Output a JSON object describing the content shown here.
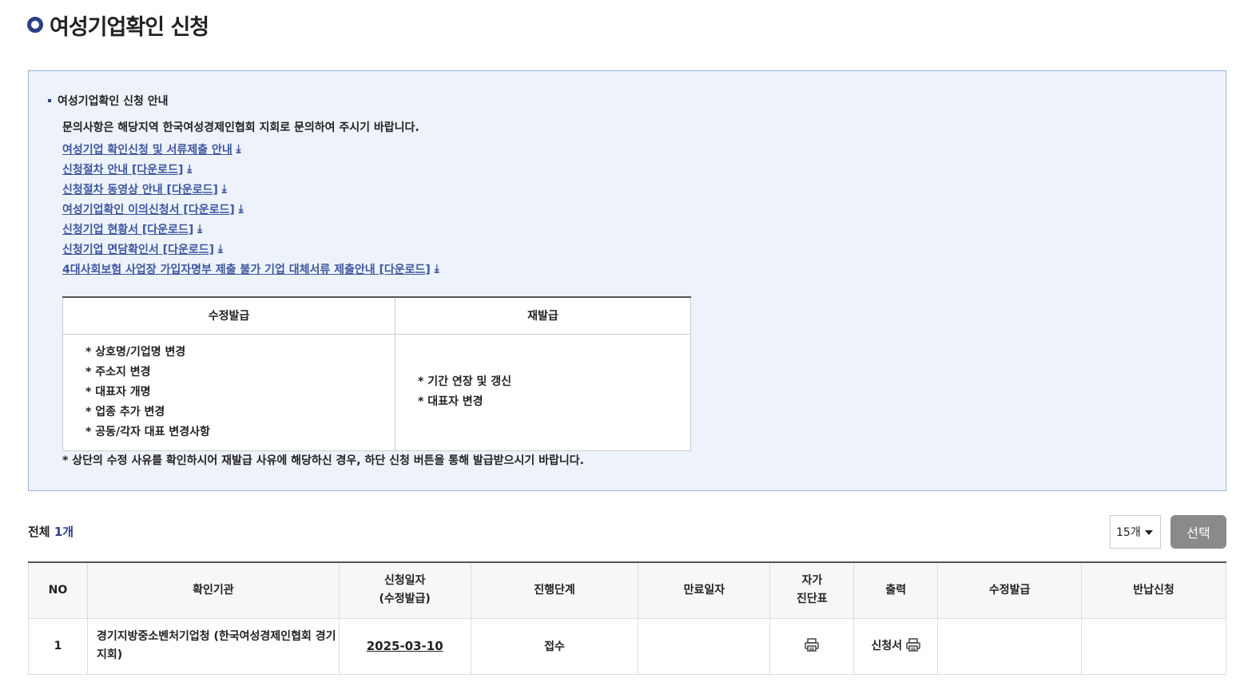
{
  "page": {
    "title": "여성기업확인 신청"
  },
  "guide": {
    "heading": "여성기업확인 신청 안내",
    "description": "문의사항은 해당지역 한국여성경제인협회 지회로 문의하여 주시기 바랍니다.",
    "links": [
      "여성기업 확인신청 및 서류제출 안내",
      "신청절차 안내 [다운로드]",
      "신청절차 동영상 안내 [다운로드]",
      "여성기업확인 이의신청서 [다운로드]",
      "신청기업 현황서 [다운로드]",
      "신청기업 면담확인서 [다운로드]",
      "4대사회보험 사업장 가입자명부 제출 불가 기업 대체서류 제출안내 [다운로드]"
    ],
    "download_icon": "download-arrow-icon",
    "table": {
      "headers": [
        "수정발급",
        "재발급"
      ],
      "modify_items": [
        "* 상호명/기업명 변경",
        "* 주소지 변경",
        "* 대표자 개명",
        "* 업종 추가 변경",
        "* 공동/각자 대표 변경사항"
      ],
      "reissue_items": [
        "* 기간 연장 및 갱신",
        "* 대표자 변경"
      ]
    },
    "note": "* 상단의 수정 사유를 확인하시어 재발급 사유에 해당하신 경우, 하단 신청 버튼을 통해 발급받으시기 바랍니다."
  },
  "list": {
    "total_label": "전체",
    "total_count": "1개",
    "per_page": "15개",
    "select_button": "선택",
    "columns": {
      "no": "NO",
      "org": "확인기관",
      "date_1": "신청일자",
      "date_2": "(수정발급)",
      "stage": "진행단계",
      "expire": "만료일자",
      "self_1": "자가",
      "self_2": "진단표",
      "print": "출력",
      "modify": "수정발급",
      "return": "반납신청"
    },
    "rows": [
      {
        "no": "1",
        "org": "경기지방중소벤처기업청 (한국여성경제인협회 경기지회)",
        "date": "2025-03-10",
        "stage": "접수",
        "expire": "",
        "print_label": "신청서",
        "modify": "",
        "return": ""
      }
    ]
  },
  "colors": {
    "accent": "#2d3f86",
    "link": "#3e569f",
    "guide_bg": "#eef3fb",
    "button_gray": "#8a8a8a"
  }
}
